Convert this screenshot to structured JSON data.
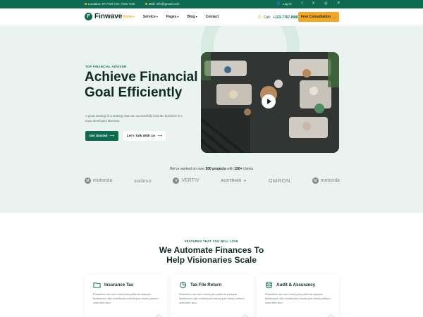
{
  "topbar": {
    "location": "Location: 57 Park Ave, New York",
    "mail": "Mail: info@gmail.com",
    "login": "Log in",
    "social": [
      "f",
      "X",
      "◎",
      "P"
    ]
  },
  "nav": {
    "logo": "Finwave",
    "menu": [
      {
        "label": "Home",
        "active": true
      },
      {
        "label": "Service",
        "active": false
      },
      {
        "label": "Pages",
        "active": false
      },
      {
        "label": "Blog",
        "active": false
      },
      {
        "label": "Contact",
        "active": false
      }
    ],
    "call_label": "Call:",
    "call_number": "+123-7767-8989",
    "cta": "Free Consultation"
  },
  "hero": {
    "eyebrow": "TOP FINANCIAL ADVISOR",
    "headline": "Achieve Financial Goal Efficiently",
    "sub": "A good strategy is a strategy that can successfully lead the business in a more developed direction.",
    "btn_primary": "Get Started",
    "btn_secondary": "Let's Talk With Us"
  },
  "clients": {
    "note_prefix": "We've worked on over ",
    "note_projects": "200 projects",
    "note_mid": " with ",
    "note_clients": "150+",
    "note_suffix": " clients",
    "logos": [
      "motorola",
      "sodexo",
      "VERTIV",
      "AUSTRIAN",
      "OMRON",
      "motorola"
    ]
  },
  "features": {
    "eyebrow": "FEATURES THAT YOU WILL LOVE",
    "title_line1": "We Automate Finances To",
    "title_line2": "Help Visionaries Scale",
    "cards": [
      {
        "icon": "folder-icon",
        "title": "Insurance Tax",
        "desc": "Phasellus nec sem inee justo pellente eqsique facilisicum uilis consequat massa quis esent pretium uisis elter anu."
      },
      {
        "icon": "chart-pie-icon",
        "title": "Tax File Return",
        "desc": "Phasellus nec sem inee justo pellente eqsique facilisicum uilis consequat massa quis esent pretium uisis elter anu."
      },
      {
        "icon": "coins-stack-icon",
        "title": "Audit & Assurancy",
        "desc": "Phasellus nec sem inee justo pellente eqsique facilisicum uilis consequat massa quis esent pretium uisis elter anu."
      }
    ]
  },
  "colors": {
    "brand": "#0e6b52",
    "accent": "#f5a623",
    "hero_bg": "#eaf3ef"
  }
}
